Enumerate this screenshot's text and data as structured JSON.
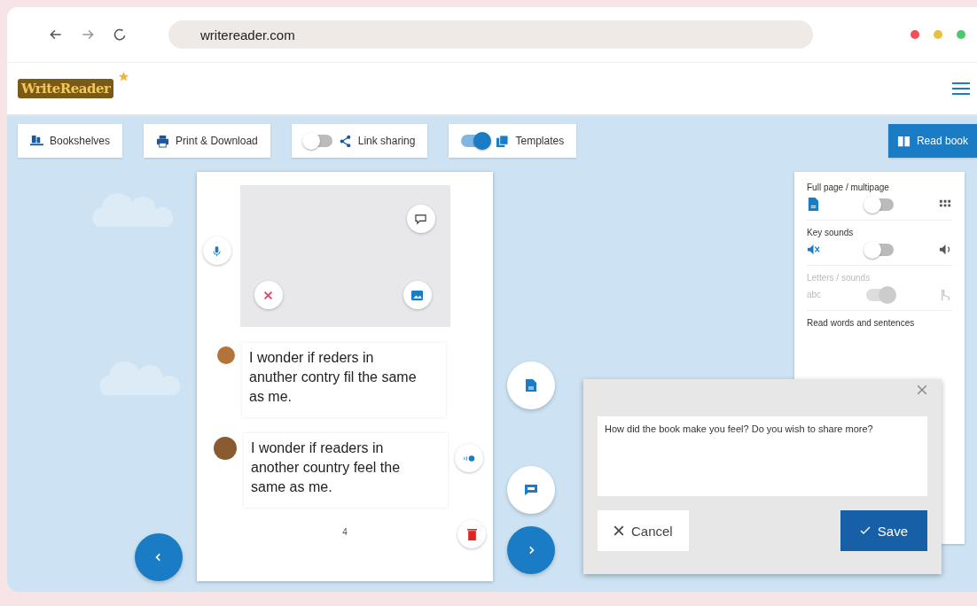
{
  "browser": {
    "url": "writereader.com"
  },
  "header": {
    "logo": "WriteReader"
  },
  "toolbar": [
    {
      "kind": "button",
      "label": "Bookshelves"
    },
    {
      "kind": "button",
      "label": "Print & Download"
    },
    {
      "kind": "toggle",
      "label": "Link sharing",
      "on": false
    },
    {
      "kind": "toggle",
      "label": "Templates",
      "on": true
    },
    {
      "kind": "primary",
      "label": "Read book"
    }
  ],
  "page": {
    "texts": [
      {
        "kind": "child",
        "text": "I wonder if reders in anuther contry fil the same as me."
      },
      {
        "kind": "adult",
        "text": "I wonder if readers in another country feel the same as me."
      }
    ],
    "page_number": "4"
  },
  "settings": {
    "rows": [
      {
        "label": "Full page / multipage",
        "on": false,
        "disabled": false
      },
      {
        "label": "Key sounds",
        "on": false,
        "disabled": false
      },
      {
        "label": "Letters / sounds",
        "left_text": "abc",
        "on": true,
        "disabled": true
      }
    ],
    "footer": "Read words and sentences"
  },
  "dialog": {
    "value": "How did the book make you feel? Do you wish to share more?",
    "cancel": "Cancel",
    "save": "Save"
  }
}
